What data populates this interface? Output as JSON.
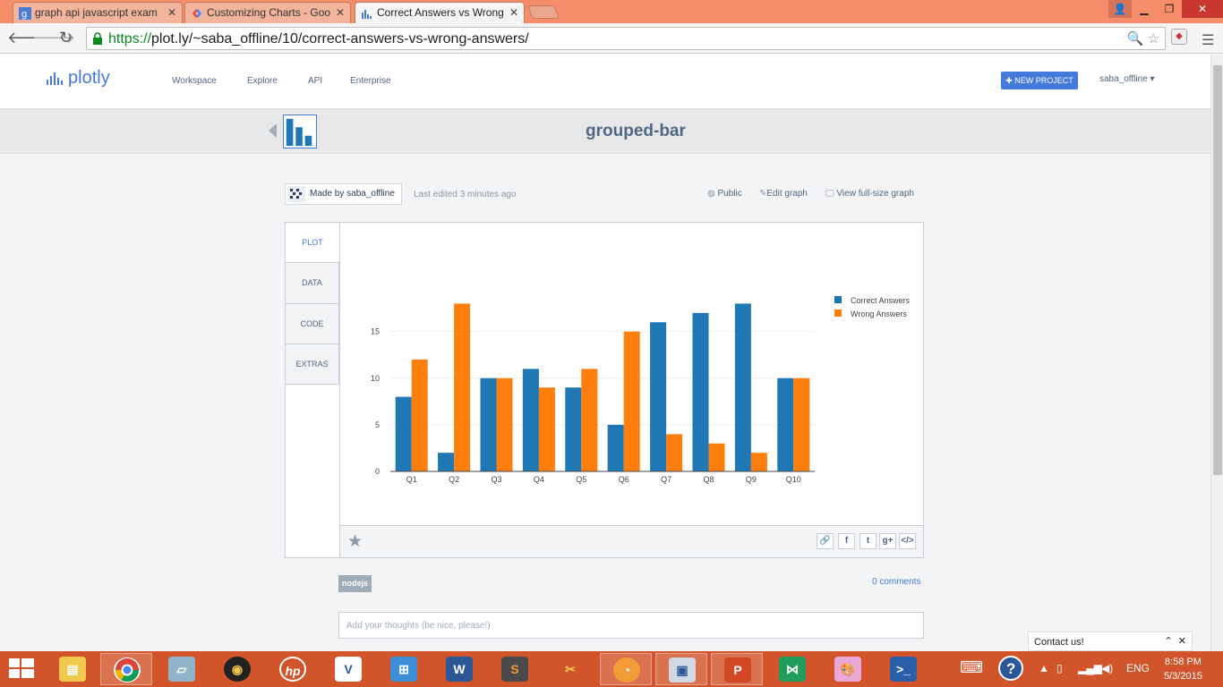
{
  "browser": {
    "tabs": [
      {
        "label": "graph api javascript exam",
        "active": false
      },
      {
        "label": "Customizing Charts - Goo",
        "active": false
      },
      {
        "label": "Correct Answers vs Wrong",
        "active": true
      }
    ],
    "url_scheme": "https://",
    "url_rest": "plot.ly/~saba_offline/10/correct-answers-vs-wrong-answers/"
  },
  "plotly": {
    "logo_text": "plotly",
    "nav": [
      "Workspace",
      "Explore",
      "API",
      "Enterprise"
    ],
    "new_project_label": "✚ NEW PROJECT",
    "user_label": "saba_offline ▾",
    "page_title": "grouped-bar",
    "made_by": "Made by saba_offline",
    "last_edited": "Last edited 3 minutes ago",
    "public_label": "Public",
    "edit_graph_label": "Edit graph",
    "view_full_label": "View full-size graph",
    "side_tabs": [
      "PLOT",
      "DATA",
      "CODE",
      "EXTRAS"
    ],
    "tag": "nodejs",
    "comments": "0 comments",
    "thoughts_placeholder": "Add your thoughts (be nice, please!)",
    "contact": "Contact us!"
  },
  "chart_data": {
    "type": "bar",
    "categories": [
      "Q1",
      "Q2",
      "Q3",
      "Q4",
      "Q5",
      "Q6",
      "Q7",
      "Q8",
      "Q9",
      "Q10"
    ],
    "series": [
      {
        "name": "Correct Answers",
        "color": "#1f77b4",
        "values": [
          8,
          2,
          10,
          11,
          9,
          5,
          16,
          17,
          18,
          10
        ]
      },
      {
        "name": "Wrong Answers",
        "color": "#ff7f0e",
        "values": [
          12,
          18,
          10,
          9,
          11,
          15,
          4,
          3,
          2,
          10
        ]
      }
    ],
    "yticks": [
      0,
      5,
      10,
      15
    ],
    "ylim": [
      0,
      19
    ],
    "grid": true,
    "legend_position": "top-right"
  },
  "taskbar": {
    "lang": "ENG",
    "time": "8:58 PM",
    "date": "5/3/2015"
  }
}
